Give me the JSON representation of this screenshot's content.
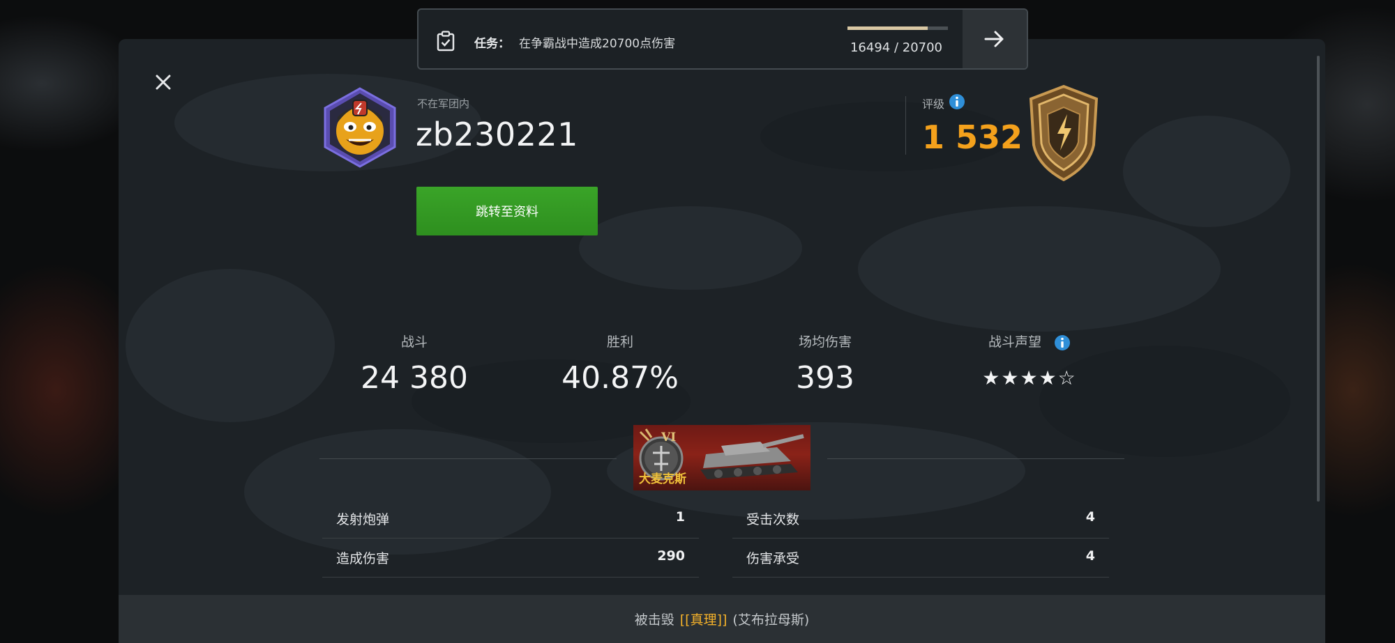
{
  "mission": {
    "label": "任务：",
    "description": "在争霸战中造成20700点伤害",
    "progress_text": "16494 / 20700",
    "progress_fraction": 0.797
  },
  "profile": {
    "clan_status": "不在军团内",
    "name": "zb230221",
    "goto_button": "跳转至资料"
  },
  "rating": {
    "label": "评级",
    "value": "1 532"
  },
  "stats": [
    {
      "label": "战斗",
      "value": "24 380"
    },
    {
      "label": "胜利",
      "value": "40.87%"
    },
    {
      "label": "场均伤害",
      "value": "393"
    },
    {
      "label": "战斗声望",
      "stars": "★★★★☆",
      "star_rating": 4
    }
  ],
  "tank": {
    "tier": "VI",
    "name": "大麦克斯"
  },
  "details_left": [
    {
      "label": "发射炮弹",
      "value": "1"
    },
    {
      "label": "造成伤害",
      "value": "290"
    }
  ],
  "details_right": [
    {
      "label": "受击次数",
      "value": "4"
    },
    {
      "label": "伤害承受",
      "value": "4"
    }
  ],
  "bottom": {
    "prefix": "被击毁",
    "clan_tag": "[[真理]]",
    "vehicle": "(艾布拉母斯)"
  },
  "colors": {
    "accent_orange": "#f4a11c",
    "button_green": "#3aa428",
    "info_blue": "#2f8fd8",
    "clan_gold": "#f4b12a"
  }
}
